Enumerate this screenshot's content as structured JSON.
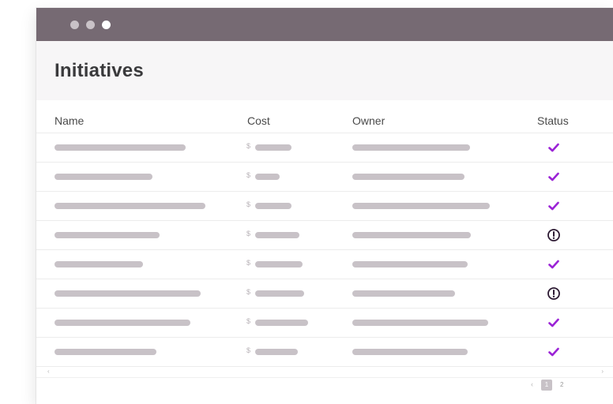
{
  "window": {
    "controls": [
      "dot-1",
      "dot-2",
      "dot-3"
    ]
  },
  "page": {
    "title": "Initiatives"
  },
  "table": {
    "columns": [
      "Name",
      "Cost",
      "Owner",
      "Status"
    ],
    "currency_symbol": "$",
    "rows": [
      {
        "status": "check"
      },
      {
        "status": "check"
      },
      {
        "status": "check"
      },
      {
        "status": "alert"
      },
      {
        "status": "check"
      },
      {
        "status": "alert"
      },
      {
        "status": "check"
      },
      {
        "status": "check"
      }
    ]
  },
  "scroll": {
    "left": "‹",
    "right": "›"
  },
  "pagination": {
    "prev": "‹",
    "pages": [
      "1",
      "2"
    ],
    "current": "1"
  },
  "colors": {
    "titlebar": "#766a73",
    "placeholder": "#c8c2c7",
    "check": "#9b23d6",
    "alert": "#2d1a33"
  }
}
